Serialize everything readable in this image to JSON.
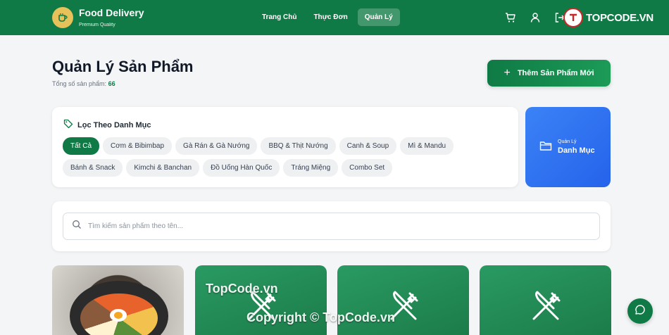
{
  "brand": {
    "title": "Food Delivery",
    "subtitle": "Premium Quality"
  },
  "nav": [
    {
      "label": "Trang Chủ",
      "active": false
    },
    {
      "label": "Thực Đơn",
      "active": false
    },
    {
      "label": "Quản Lý",
      "active": true
    }
  ],
  "header_icons": [
    "cart-icon",
    "user-icon",
    "logout-icon"
  ],
  "watermark": {
    "badge": "TOPCODE.VN",
    "text1": "TopCode.vn",
    "text2": "Copyright © TopCode.vn"
  },
  "page": {
    "title": "Quản Lý Sản Phẩm",
    "count_label": "Tổng số sản phẩm:",
    "count_value": "66",
    "add_button": "Thêm Sản Phẩm Mới"
  },
  "filter": {
    "title": "Lọc Theo Danh Mục",
    "chips": [
      "Tất Cả",
      "Cơm & Bibimbap",
      "Gà Rán & Gà Nướng",
      "BBQ & Thịt Nướng",
      "Canh & Soup",
      "Mì & Mandu",
      "Bánh & Snack",
      "Kimchi & Banchan",
      "Đồ Uống Hàn Quốc",
      "Tráng Miệng",
      "Combo Set"
    ],
    "active_index": 0
  },
  "category_card": {
    "small": "Quản Lý",
    "big": "Danh Mục"
  },
  "search": {
    "placeholder": "Tìm kiếm sản phẩm theo tên..."
  },
  "colors": {
    "primary": "#0f7a45",
    "accent_blue": "#2563eb",
    "logo_yellow": "#e7c15a"
  }
}
